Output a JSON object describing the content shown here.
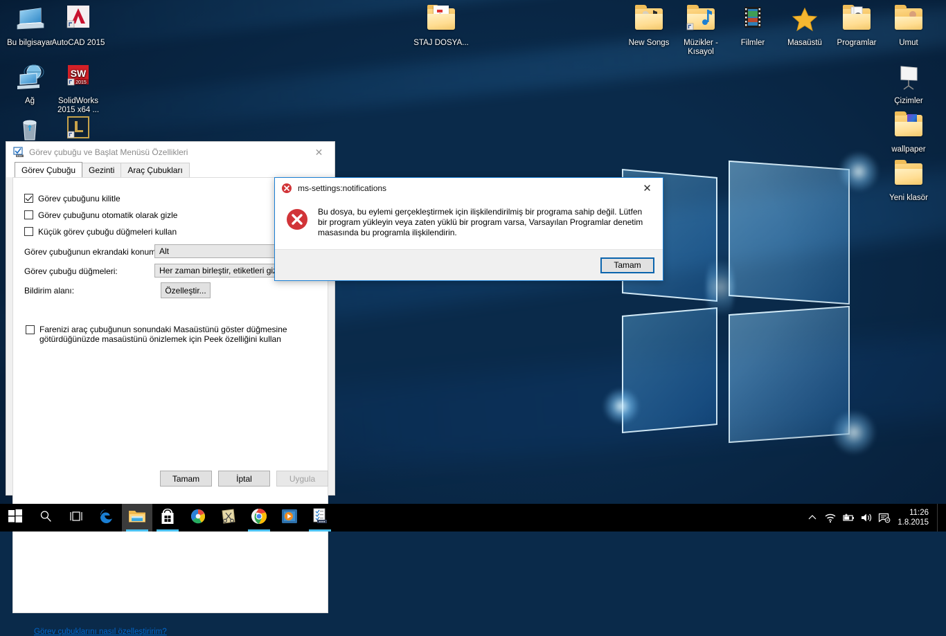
{
  "desktop": {
    "icons_left": [
      {
        "label": "Bu bilgisayar",
        "icon": "this-pc-icon"
      },
      {
        "label": "AutoCAD 2015",
        "icon": "autocad-icon"
      },
      {
        "label": "Ağ",
        "icon": "network-icon"
      },
      {
        "label": "SolidWorks 2015 x64 ...",
        "icon": "solidworks-icon"
      },
      {
        "label": "",
        "icon": "recycle-bin-icon"
      },
      {
        "label": "",
        "icon": "league-of-legends-icon"
      }
    ],
    "icons_center": [
      {
        "label": "STAJ DOSYA...",
        "icon": "folder-document-icon"
      }
    ],
    "icons_top_right": [
      {
        "label": "New Songs",
        "icon": "folder-music-icon"
      },
      {
        "label": "Müzikler - Kısayol",
        "icon": "folder-music-shortcut-icon"
      },
      {
        "label": "Filmler",
        "icon": "film-strip-icon"
      },
      {
        "label": "Masaüstü",
        "icon": "star-icon"
      },
      {
        "label": "Programlar",
        "icon": "folder-programs-icon"
      },
      {
        "label": "Umut",
        "icon": "folder-user-icon"
      }
    ],
    "icons_right": [
      {
        "label": "Çizimler",
        "icon": "presentation-board-icon"
      },
      {
        "label": "wallpaper",
        "icon": "folder-pictures-icon"
      },
      {
        "label": "Yeni klasör",
        "icon": "folder-icon"
      }
    ]
  },
  "properties_dialog": {
    "title": "Görev çubuğu ve Başlat Menüsü Özellikleri",
    "title_icon": "taskbar-properties-icon",
    "close_label": "✕",
    "tabs": [
      {
        "label": "Görev Çubuğu",
        "selected": true
      },
      {
        "label": "Gezinti",
        "selected": false
      },
      {
        "label": "Araç Çubukları",
        "selected": false
      }
    ],
    "checkboxes": [
      {
        "label": "Görev çubuğunu kilitle",
        "checked": true
      },
      {
        "label": "Görev çubuğunu otomatik olarak gizle",
        "checked": false
      },
      {
        "label": "Küçük görev çubuğu düğmeleri kullan",
        "checked": false
      }
    ],
    "fields": [
      {
        "label": "Görev çubuğunun ekrandaki konumu:",
        "value": "Alt"
      },
      {
        "label": "Görev çubuğu düğmeleri:",
        "value": "Her zaman birleştir, etiketleri gizle"
      }
    ],
    "notification_area": {
      "label": "Bildirim alanı:",
      "button_label": "Özelleştir..."
    },
    "peek_checkbox": {
      "label": "Farenizi araç çubuğunun sonundaki Masaüstünü göster düğmesine götürdüğünüzde masaüstünü önizlemek için Peek özelliğini kullan",
      "checked": false
    },
    "help_link": "Görev çubuklarını nasıl özelleştiririm?",
    "buttons": [
      {
        "label": "Tamam",
        "disabled": false
      },
      {
        "label": "İptal",
        "disabled": false
      },
      {
        "label": "Uygula",
        "disabled": true
      }
    ]
  },
  "error_dialog": {
    "title": "ms-settings:notifications",
    "title_icon": "error-small-icon",
    "body_icon": "error-large-icon",
    "close_label": "✕",
    "message": "Bu dosya, bu eylemi gerçekleştirmek için ilişkilendirilmiş bir programa sahip değil. Lütfen bir program yükleyin veya zaten yüklü bir program varsa, Varsayılan Programlar denetim masasında bu programla ilişkilendirin.",
    "ok_label": "Tamam",
    "accent_color": "#0a64ad",
    "error_color": "#d13438"
  },
  "taskbar": {
    "start_icon": "windows-start-icon",
    "search_icon": "search-icon",
    "taskview_icon": "task-view-icon",
    "pinned": [
      {
        "name": "edge-icon",
        "running": false,
        "active": false
      },
      {
        "name": "file-explorer-icon",
        "running": true,
        "active": true
      },
      {
        "name": "microsoft-store-icon",
        "running": true,
        "active": false
      },
      {
        "name": "photo-viewer-icon",
        "running": false,
        "active": false
      },
      {
        "name": "snipping-tool-icon",
        "running": false,
        "active": false
      },
      {
        "name": "google-chrome-icon",
        "running": true,
        "active": false
      },
      {
        "name": "media-player-icon",
        "running": false,
        "active": false
      },
      {
        "name": "autocad-doc-icon",
        "running": true,
        "active": false
      }
    ],
    "tray": {
      "chevron_icon": "show-hidden-icons-chevron",
      "icons": [
        "wifi-icon",
        "battery-charging-icon",
        "volume-icon",
        "action-center-icon"
      ],
      "time": "11:26",
      "date": "1.8.2015"
    }
  }
}
